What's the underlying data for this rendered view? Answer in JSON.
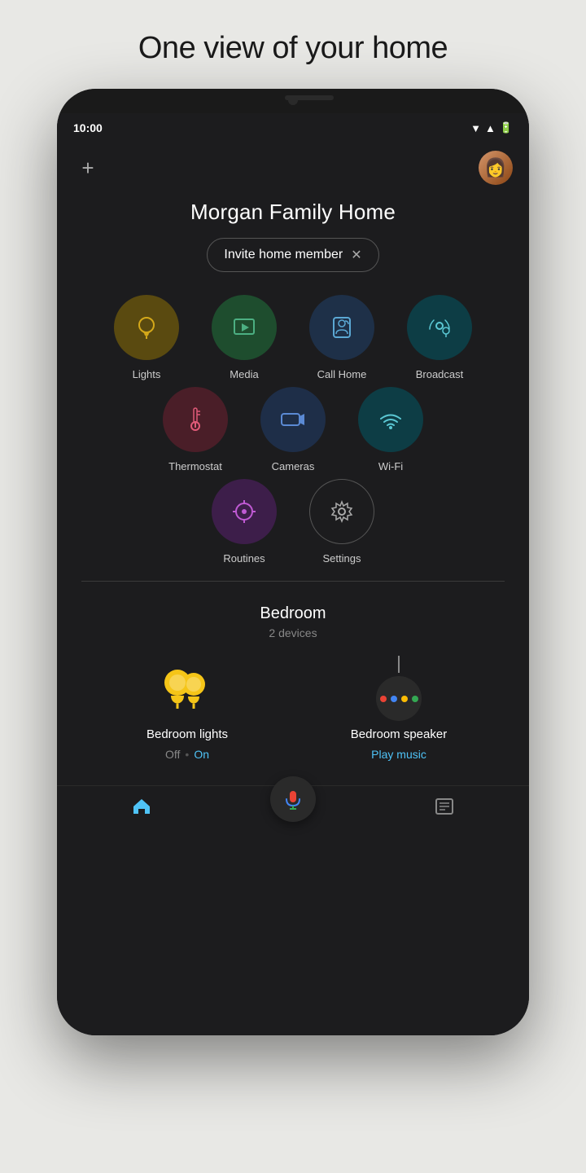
{
  "page": {
    "title": "One view of your home"
  },
  "status_bar": {
    "time": "10:00"
  },
  "header": {
    "add_label": "+",
    "home_name": "Morgan Family Home"
  },
  "invite_pill": {
    "label": "Invite home member",
    "close": "✕"
  },
  "grid": {
    "row1": [
      {
        "id": "lights",
        "label": "Lights",
        "circle_class": "circle-lights"
      },
      {
        "id": "media",
        "label": "Media",
        "circle_class": "circle-media"
      },
      {
        "id": "callhome",
        "label": "Call Home",
        "circle_class": "circle-callhome"
      },
      {
        "id": "broadcast",
        "label": "Broadcast",
        "circle_class": "circle-broadcast"
      }
    ],
    "row2": [
      {
        "id": "thermostat",
        "label": "Thermostat",
        "circle_class": "circle-thermostat"
      },
      {
        "id": "cameras",
        "label": "Cameras",
        "circle_class": "circle-cameras"
      },
      {
        "id": "wifi",
        "label": "Wi-Fi",
        "circle_class": "circle-wifi"
      }
    ],
    "row3": [
      {
        "id": "routines",
        "label": "Routines",
        "circle_class": "circle-routines"
      },
      {
        "id": "settings",
        "label": "Settings",
        "circle_class": "circle-settings"
      }
    ]
  },
  "bedroom": {
    "title": "Bedroom",
    "subtitle": "2 devices",
    "devices": [
      {
        "id": "bedroom-lights",
        "name": "Bedroom lights",
        "status_off": "Off",
        "dot": "•",
        "status_on": "On"
      },
      {
        "id": "bedroom-speaker",
        "name": "Bedroom speaker",
        "action": "Play music"
      }
    ]
  },
  "bottom_nav": {
    "home_icon": "🏠",
    "list_icon": "📋"
  }
}
